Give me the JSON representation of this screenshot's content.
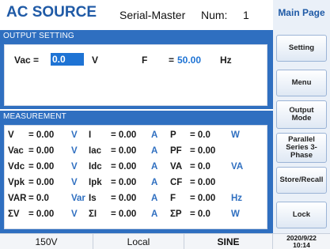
{
  "header": {
    "title": "AC SOURCE",
    "mode": "Serial-Master",
    "num_label": "Num:",
    "num_value": "1",
    "page_label": "Main Page"
  },
  "output_setting": {
    "title": "OUTPUT SETTING",
    "vac_label": "Vac =",
    "vac_value": "0.0",
    "vac_unit": "V",
    "f_label": "F",
    "f_eq": "=",
    "f_value": "50.00",
    "f_unit": "Hz"
  },
  "measurement": {
    "title": "MEASUREMENT",
    "rows": [
      [
        {
          "l": "V",
          "v": "= 0.00",
          "u": "V"
        },
        {
          "l": "I",
          "v": "= 0.00",
          "u": "A"
        },
        {
          "l": "P",
          "v": "= 0.0",
          "u": "W"
        }
      ],
      [
        {
          "l": "Vac",
          "v": "= 0.00",
          "u": "V"
        },
        {
          "l": "Iac",
          "v": "= 0.00",
          "u": "A"
        },
        {
          "l": "PF",
          "v": "= 0.00",
          "u": ""
        }
      ],
      [
        {
          "l": "Vdc",
          "v": "= 0.00",
          "u": "V"
        },
        {
          "l": "Idc",
          "v": "= 0.00",
          "u": "A"
        },
        {
          "l": "VA",
          "v": "= 0.0",
          "u": "VA"
        }
      ],
      [
        {
          "l": "Vpk",
          "v": "= 0.00",
          "u": "V"
        },
        {
          "l": "Ipk",
          "v": "= 0.00",
          "u": "A"
        },
        {
          "l": "CF",
          "v": "= 0.00",
          "u": ""
        }
      ],
      [
        {
          "l": "VAR",
          "v": "= 0.0",
          "u": "Var"
        },
        {
          "l": "Is",
          "v": "= 0.00",
          "u": "A"
        },
        {
          "l": "F",
          "v": "= 0.00",
          "u": "Hz"
        }
      ],
      [
        {
          "l": "ΣV",
          "v": "= 0.00",
          "u": "V"
        },
        {
          "l": "ΣI",
          "v": "= 0.00",
          "u": "A"
        },
        {
          "l": "ΣP",
          "v": "= 0.0",
          "u": "W"
        }
      ]
    ]
  },
  "sidebar": {
    "buttons": [
      "Setting",
      "Menu",
      "Output Mode",
      "Parallel Series 3-Phase",
      "Store/Recall",
      "Lock"
    ]
  },
  "status": {
    "range": "150V",
    "control": "Local",
    "waveform": "SINE",
    "date": "2020/9/22",
    "time": "10:14"
  },
  "colors": {
    "accent": "#1f5aa6",
    "section_bg": "#2f6fc0",
    "input_highlight": "#1e73d4"
  }
}
